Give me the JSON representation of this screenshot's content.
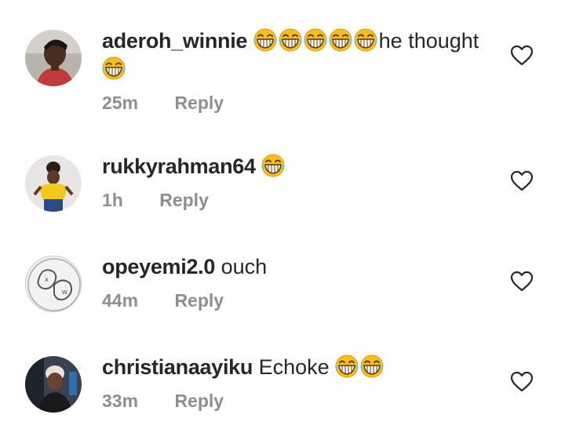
{
  "comments": [
    {
      "username": "aderoh_winnie",
      "text_after_emojis": "he thought",
      "leading_emojis": [
        "laugh-emoji",
        "laugh-emoji",
        "laugh-emoji",
        "laugh-emoji",
        "laugh-emoji"
      ],
      "trailing_emojis_line2": [
        "laugh-emoji"
      ],
      "time": "25m",
      "reply": "Reply",
      "like_icon": "heart-outline-icon"
    },
    {
      "username": "rukkyrahman64",
      "text": "",
      "emojis": [
        "laugh-emoji"
      ],
      "time": "1h",
      "reply": "Reply",
      "like_icon": "heart-outline-icon"
    },
    {
      "username": "opeyemi2.0",
      "text": "ouch",
      "emojis": [],
      "time": "44m",
      "reply": "Reply",
      "like_icon": "heart-outline-icon"
    },
    {
      "username": "christianaayiku",
      "text": "Echoke",
      "emojis": [
        "laugh-emoji",
        "laugh-emoji"
      ],
      "time": "33m",
      "reply": "Reply",
      "like_icon": "heart-outline-icon"
    }
  ],
  "colors": {
    "text": "#262626",
    "meta": "#8e8e8e",
    "emoji_face": "#f7b900",
    "background": "#ffffff"
  }
}
